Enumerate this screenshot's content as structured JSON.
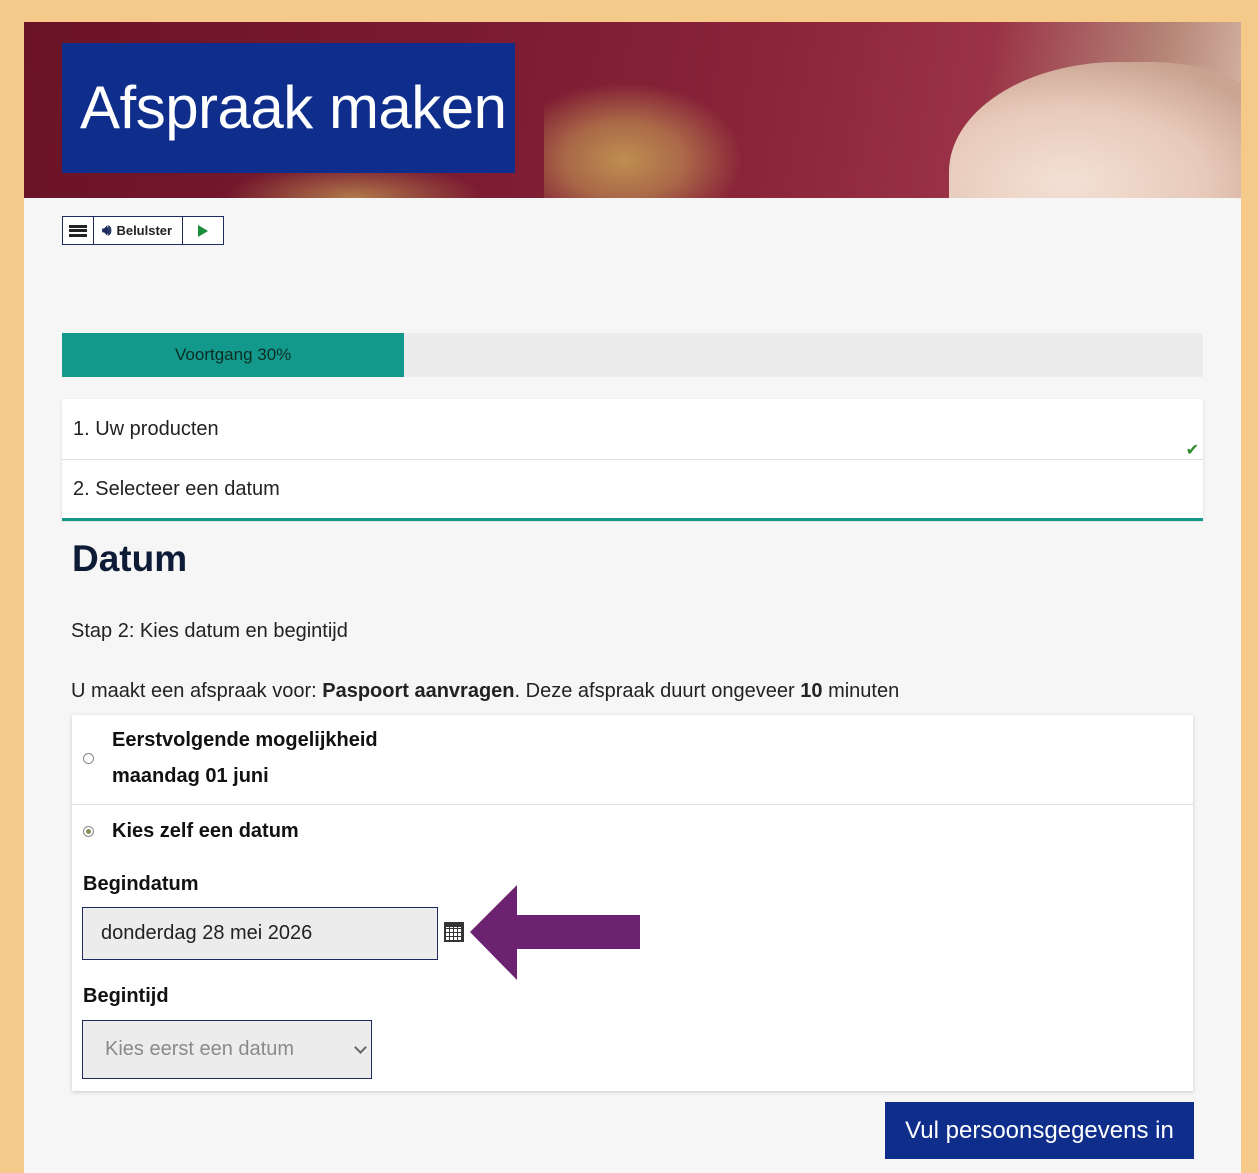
{
  "hero": {
    "title": "Afspraak maken"
  },
  "readspeaker": {
    "listen_label": "Belulster"
  },
  "progress": {
    "label": "Voortgang 30%",
    "percent": 30
  },
  "steps": [
    {
      "label": "1. Uw producten",
      "done": true
    },
    {
      "label": "2. Selecteer een datum",
      "done": false
    }
  ],
  "main": {
    "heading": "Datum",
    "subtitle": "Stap 2: Kies datum en begintijd",
    "info": {
      "prefix": "U maakt een afspraak voor: ",
      "product": "Paspoort aanvragen",
      "middle": ". Deze afspraak duurt ongeveer ",
      "duration": "10",
      "suffix": " minuten"
    },
    "options": {
      "first_title": "Eerstvolgende mogelijkheid",
      "first_date": "maandag 01 juni",
      "own_title": "Kies zelf een datum"
    },
    "begindatum_label": "Begindatum",
    "begindatum_value": "donderdag 28 mei 2026",
    "begintijd_label": "Begintijd",
    "begintijd_placeholder": "Kies eerst een datum",
    "next_button": "Vul persoonsgegevens in"
  },
  "colors": {
    "brand_blue": "#0f2e8c",
    "progress_teal": "#13998b",
    "arrow_purple": "#6b2270",
    "frame": "#f5c98a"
  }
}
